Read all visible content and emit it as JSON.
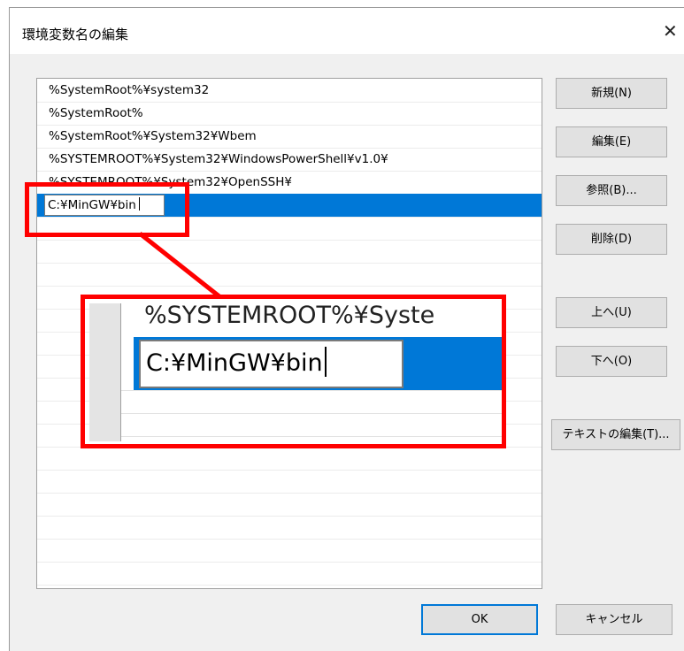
{
  "dialog": {
    "title": "環境変数名の編集",
    "close_symbol": "✕"
  },
  "list": {
    "items": [
      "%SystemRoot%¥system32",
      "%SystemRoot%",
      "%SystemRoot%¥System32¥Wbem",
      "%SYSTEMROOT%¥System32¥WindowsPowerShell¥v1.0¥",
      "%SYSTEMROOT%¥System32¥OpenSSH¥"
    ],
    "editing_value": "C:¥MinGW¥bin"
  },
  "buttons": {
    "new": "新規(N)",
    "edit": "編集(E)",
    "browse": "参照(B)...",
    "delete": "削除(D)",
    "move_up": "上へ(U)",
    "move_down": "下へ(O)",
    "edit_text": "テキストの編集(T)...",
    "ok": "OK",
    "cancel": "キャンセル"
  },
  "zoom_callout": {
    "row_text": "%SYSTEMROOT%¥Syste",
    "edit_text": "C:¥MinGW¥bin"
  },
  "colors": {
    "selection": "#0078d7",
    "highlight": "#ff0000"
  }
}
